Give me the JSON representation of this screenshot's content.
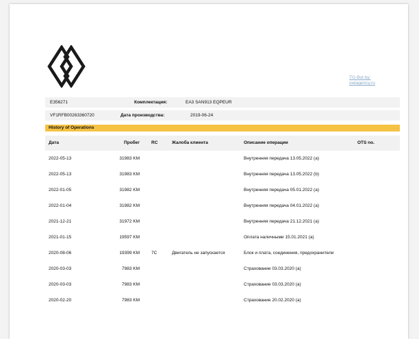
{
  "header": {
    "credit_line1": "TG-Bot by:",
    "credit_line2": "owlagency.ru"
  },
  "vehicle": {
    "code": "E356271",
    "trim_label": "Комплектация:",
    "trim_value": "EA3   SAN913 EQPEUR",
    "vin": "VF1RFB00263360720",
    "date_label": "Дата производства:",
    "date_value": "2019-06-24"
  },
  "section_title": "History of Operations",
  "table": {
    "headers": {
      "date": "Дата",
      "mileage": "Пробег",
      "rc": "RC",
      "complaint": "Жалоба клиента",
      "description": "Описание операции",
      "ots": "OTS no."
    },
    "rows": [
      {
        "date": "2022-05-13",
        "mileage": "31983 KM",
        "rc": "",
        "complaint": "",
        "description": "Внутренняя передача 13.05.2022 (a)",
        "ots": ""
      },
      {
        "date": "2022-05-13",
        "mileage": "31983 KM",
        "rc": "",
        "complaint": "",
        "description": "Внутренняя передача 13.05.2022 (b)",
        "ots": ""
      },
      {
        "date": "2022-01-05",
        "mileage": "31982 KM",
        "rc": "",
        "complaint": "",
        "description": "Внутренняя передача 05.01.2022 (a)",
        "ots": ""
      },
      {
        "date": "2022-01-04",
        "mileage": "31982 KM",
        "rc": "",
        "complaint": "",
        "description": "Внутренняя передача 04.01.2022 (a)",
        "ots": ""
      },
      {
        "date": "2021-12-21",
        "mileage": "31972 KM",
        "rc": "",
        "complaint": "",
        "description": "Внутренняя передача 21.12.2021 (a)",
        "ots": ""
      },
      {
        "date": "2021-01-15",
        "mileage": "19597 KM",
        "rc": "",
        "complaint": "",
        "description": "Оплата наличными 15.01.2021 (a)",
        "ots": ""
      },
      {
        "date": "2020-08-06",
        "mileage": "19399 KM",
        "rc": "7C",
        "complaint": "Двигатель не запускается",
        "description": "Блок и плата, соединения, предохранители",
        "ots": ""
      },
      {
        "date": "2020-03-03",
        "mileage": "7983 KM",
        "rc": "",
        "complaint": "",
        "description": "Страхование 03.03.2020 (a)",
        "ots": ""
      },
      {
        "date": "2020-03-03",
        "mileage": "7983 KM",
        "rc": "",
        "complaint": "",
        "description": "Страхование 03.03.2020 (a)",
        "ots": ""
      },
      {
        "date": "2020-02-20",
        "mileage": "7983 KM",
        "rc": "",
        "complaint": "",
        "description": "Страхование 20.02.2020 (a)",
        "ots": ""
      }
    ]
  }
}
